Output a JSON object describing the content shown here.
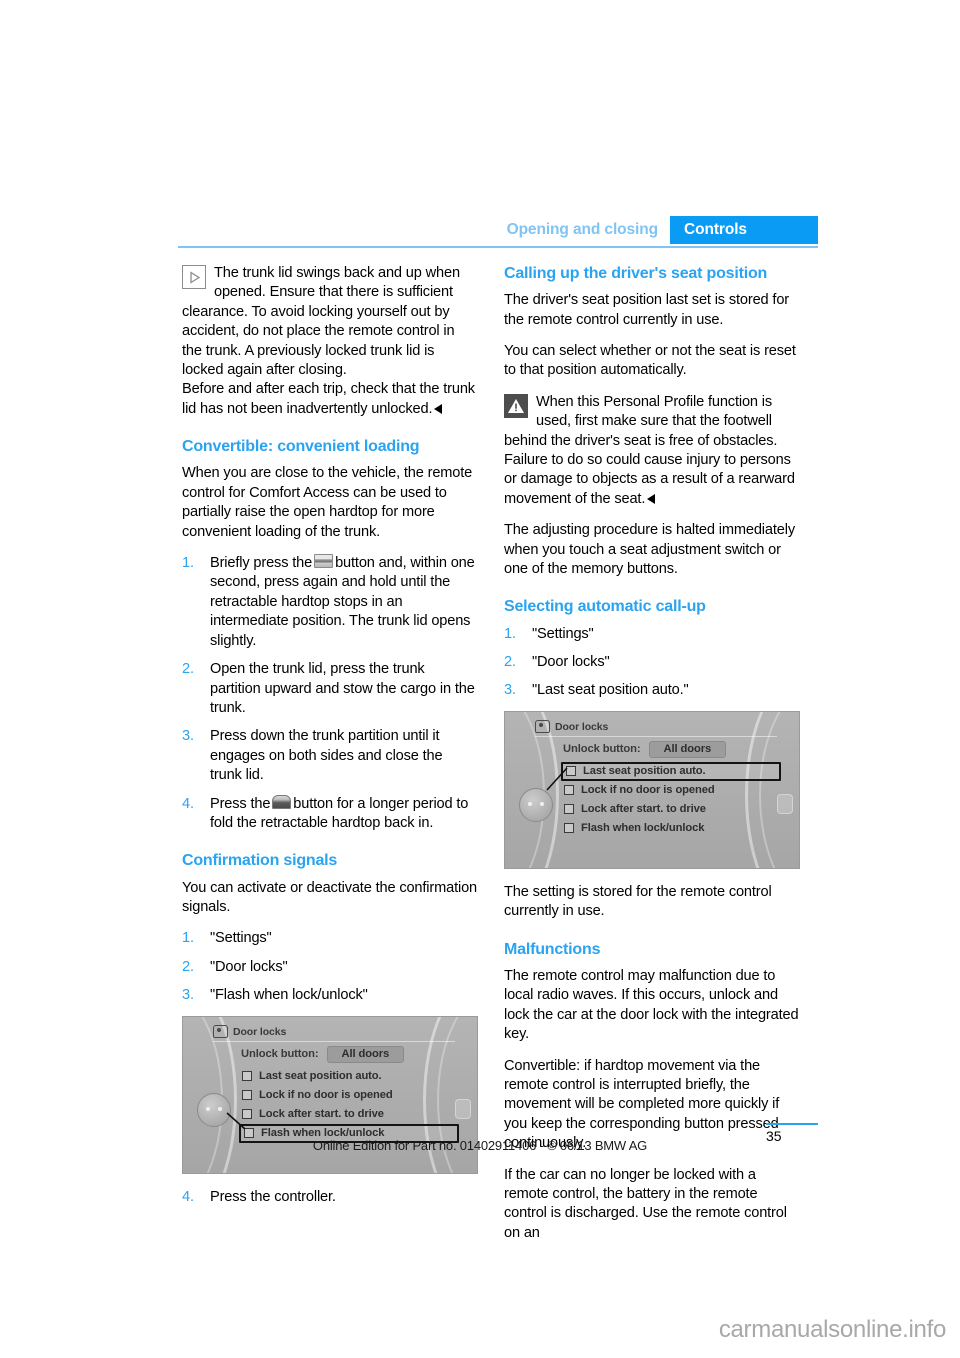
{
  "header": {
    "chapter": "Opening and closing",
    "section": "Controls",
    "accent_color": "#0a9bf5",
    "accent_light": "#7fc4f5"
  },
  "left_column": {
    "note": {
      "icon": "triangle-play-icon",
      "text": "The trunk lid swings back and up when opened. Ensure that there is sufficient clearance. To avoid locking yourself out by accident, do not place the remote control in the trunk. A previously locked trunk lid is locked again after closing.",
      "text2": "Before and after each trip, check that the trunk lid has not been inadvertently unlocked."
    },
    "heading1": "Convertible: convenient loading",
    "para1": "When you are close to the vehicle, the remote control for Comfort Access can be used to partially raise the open hardtop for more convenient loading of the trunk.",
    "steps1": [
      {
        "num": "1.",
        "text_a": "Briefly press the",
        "icon": "trunk-open-button-icon",
        "text_b": "button and, within one second, press again and hold until the retractable hardtop stops in an intermediate position. The trunk lid opens slightly."
      },
      {
        "num": "2.",
        "text_a": "Open the trunk lid, press the trunk partition upward and stow the cargo in the trunk.",
        "icon": "",
        "text_b": ""
      },
      {
        "num": "3.",
        "text_a": "Press down the trunk partition until it engages on both sides and close the trunk lid.",
        "icon": "",
        "text_b": ""
      },
      {
        "num": "4.",
        "text_a": "Press the",
        "icon": "hardtop-close-button-icon",
        "text_b": "button for a longer period to fold the retractable hardtop back in."
      }
    ],
    "heading2": "Confirmation signals",
    "para2": "You can activate or deactivate the confirmation signals.",
    "steps2": [
      {
        "num": "1.",
        "text": "\"Settings\""
      },
      {
        "num": "2.",
        "text": "\"Door locks\""
      },
      {
        "num": "3.",
        "text": "\"Flash when lock/unlock\""
      }
    ],
    "figure": {
      "title": "Door locks",
      "unlock_label": "Unlock button:",
      "unlock_value": "All doors",
      "rows": [
        {
          "text": "Last seat position auto.",
          "highlighted": false
        },
        {
          "text": "Lock if no door is opened",
          "highlighted": false
        },
        {
          "text": "Lock after start. to drive",
          "highlighted": false
        },
        {
          "text": "Flash when lock/unlock",
          "highlighted": true
        }
      ]
    },
    "steps3": [
      {
        "num": "4.",
        "text": "Press the controller."
      }
    ]
  },
  "right_column": {
    "heading1": "Calling up the driver's seat position",
    "para1": "The driver's seat position last set is stored for the remote control currently in use.",
    "para2": "You can select whether or not the seat is reset to that position automatically.",
    "warning": {
      "icon": "warning-triangle-icon",
      "text": "When this Personal Profile function is used, first make sure that the footwell behind the driver's seat is free of obstacles. Failure to do so could cause injury to persons or damage to objects as a result of a rearward movement of the seat."
    },
    "para3": "The adjusting procedure is halted immediately when you touch a seat adjustment switch or one of the memory buttons.",
    "heading2": "Selecting automatic call-up",
    "steps1": [
      {
        "num": "1.",
        "text": "\"Settings\""
      },
      {
        "num": "2.",
        "text": "\"Door locks\""
      },
      {
        "num": "3.",
        "text": "\"Last seat position auto.\""
      }
    ],
    "figure": {
      "title": "Door locks",
      "unlock_label": "Unlock button:",
      "unlock_value": "All doors",
      "rows": [
        {
          "text": "Last seat position auto.",
          "highlighted": true
        },
        {
          "text": "Lock if no door is opened",
          "highlighted": false
        },
        {
          "text": "Lock after start. to drive",
          "highlighted": false
        },
        {
          "text": "Flash when lock/unlock",
          "highlighted": false
        }
      ]
    },
    "para4": "The setting is stored for the remote control currently in use.",
    "heading3": "Malfunctions",
    "para5": "The remote control may malfunction due to local radio waves. If this occurs, unlock and lock the car at the door lock with the integrated key.",
    "para6": "Convertible: if hardtop movement via the remote control is interrupted briefly, the movement will be completed more quickly if you keep the corresponding button pressed continuously.",
    "para7": "If the car can no longer be locked with a remote control, the battery in the remote control is discharged. Use the remote control on an"
  },
  "footer": {
    "page_number": "35",
    "edition": "Online Edition for Part no. 01402911406 - © 06/13 BMW AG",
    "watermark": "carmanualsonline.info"
  }
}
